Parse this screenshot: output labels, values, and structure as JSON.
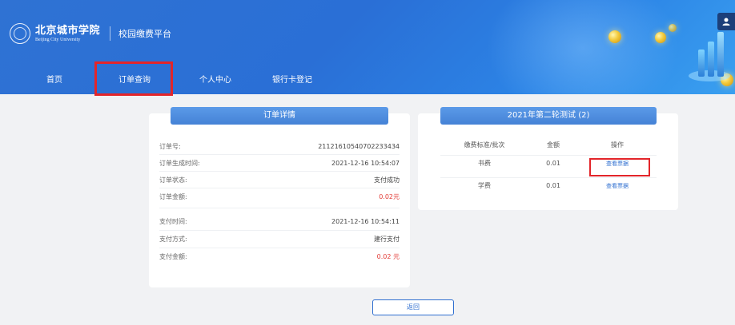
{
  "header": {
    "school_name_cn": "北京城市学院",
    "school_name_en": "Beijing City University",
    "platform_title": "校园缴费平台"
  },
  "nav": {
    "items": [
      {
        "label": "首页"
      },
      {
        "label": "订单查询",
        "active": true
      },
      {
        "label": "个人中心"
      },
      {
        "label": "银行卡登记"
      }
    ]
  },
  "order_detail": {
    "title": "订单详情",
    "fields": [
      {
        "label": "订单号:",
        "value": "2112161054070223343​4"
      },
      {
        "label": "订单生成时间:",
        "value": "2021-12-16 10:54:07"
      },
      {
        "label": "订单状态:",
        "value": "支付成功"
      },
      {
        "label": "订单金额:",
        "value": "0.02元"
      }
    ],
    "payment_fields": [
      {
        "label": "支付时间:",
        "value": "2021-12-16 10:54:11"
      },
      {
        "label": "支付方式:",
        "value": "建行支付"
      },
      {
        "label": "支付金额:",
        "value": "0.02 元"
      }
    ]
  },
  "fee_list": {
    "title": "2021年第二轮测试 (2)",
    "columns": [
      "缴费标准/批次",
      "金额",
      "操作"
    ],
    "rows": [
      {
        "name": "书费",
        "amount": "0.01",
        "action": "查看票据"
      },
      {
        "name": "学费",
        "amount": "0.01",
        "action": "查看票据"
      }
    ]
  },
  "footer": {
    "back_label": "返回"
  },
  "colors": {
    "header_blue": "#2f72d3",
    "accent_blue": "#4582d6",
    "highlight_red": "#e3252a",
    "amount_red": "#e23a35"
  }
}
